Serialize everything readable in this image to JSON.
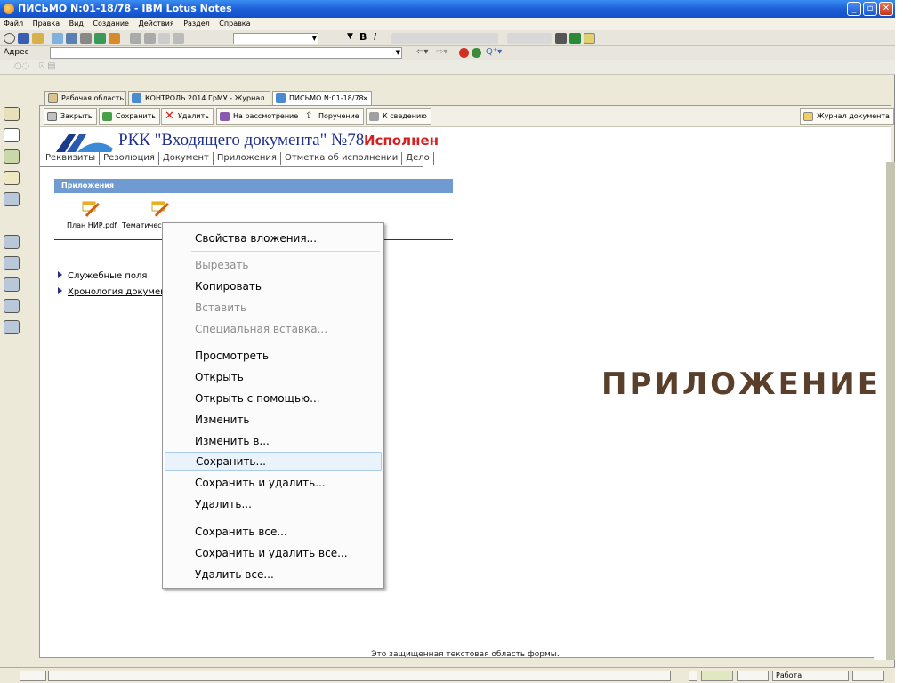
{
  "window": {
    "title": "ПИСЬМО N:01-18/78 - IBM Lotus Notes"
  },
  "menubar": [
    "Файл",
    "Правка",
    "Вид",
    "Создание",
    "Действия",
    "Раздел",
    "Справка"
  ],
  "toolbar": {
    "font_combo_value": "",
    "bold_label": "B",
    "italic_label": "I"
  },
  "addressbar": {
    "label": "Адрес",
    "value": ""
  },
  "tabs": [
    {
      "label": "Рабочая область",
      "icon": "workspace-icon"
    },
    {
      "label": "КОНТРОЛЬ 2014 ГрМУ - Журнал...",
      "icon": "database-icon"
    },
    {
      "label": "ПИСЬМО N:01-18/78",
      "icon": "document-icon"
    }
  ],
  "actions": [
    {
      "label": "Закрыть",
      "icon": "close-doc-icon"
    },
    {
      "label": "Сохранить",
      "icon": "save-icon"
    },
    {
      "label": "Удалить",
      "icon": "delete-icon"
    },
    {
      "label": "На рассмотрение",
      "icon": "review-icon"
    },
    {
      "label": "Поручение",
      "icon": "assign-icon"
    },
    {
      "label": "К сведению",
      "icon": "info-icon"
    },
    {
      "label": "Журнал документа",
      "icon": "journal-icon"
    }
  ],
  "document": {
    "title": "РКК \"Входящего документа\" №78",
    "status": "Исполнен",
    "tabs": [
      "Реквизиты",
      "Резолюция",
      "Документ",
      "Приложения",
      "Отметка об исполнении",
      "Дело"
    ],
    "attachments_header": "Приложения",
    "attachments": [
      {
        "label": "План НИР.pdf"
      },
      {
        "label": "Тематическ"
      }
    ],
    "sections": [
      {
        "label": "Служебные поля"
      },
      {
        "label": "Хронология докумен"
      }
    ],
    "protected_text": "Это защищенная текстовая область формы."
  },
  "context_menu": {
    "items": [
      {
        "label": "Свойства вложения...",
        "disabled": false
      },
      {
        "label": "Вырезать",
        "disabled": true
      },
      {
        "label": "Копировать",
        "disabled": false
      },
      {
        "label": "Вставить",
        "disabled": true
      },
      {
        "label": "Специальная вставка...",
        "disabled": true
      },
      {
        "label": "Просмотреть",
        "disabled": false
      },
      {
        "label": "Открыть",
        "disabled": false
      },
      {
        "label": "Открыть с помощью...",
        "disabled": false
      },
      {
        "label": "Изменить",
        "disabled": false
      },
      {
        "label": "Изменить в...",
        "disabled": false
      },
      {
        "label": "Сохранить...",
        "disabled": false,
        "highlighted": true
      },
      {
        "label": "Сохранить и удалить...",
        "disabled": false
      },
      {
        "label": "Удалить...",
        "disabled": false
      },
      {
        "label": "Сохранить все...",
        "disabled": false
      },
      {
        "label": "Сохранить и удалить все...",
        "disabled": false
      },
      {
        "label": "Удалить все...",
        "disabled": false
      }
    ]
  },
  "statusbar": {
    "location": "Работа"
  },
  "slide": {
    "title": "ПРИЛОЖЕНИЕ"
  },
  "colors": {
    "titlebar": "#1c5fd8",
    "doc_title": "#1f2f8c",
    "status": "#d42020",
    "section_header": "#6f9bd1",
    "slide_title": "#5a3f2a",
    "menu_highlight": "#eaf3fc"
  }
}
